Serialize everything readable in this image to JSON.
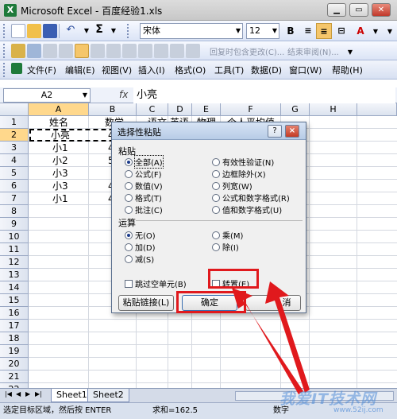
{
  "window": {
    "title": "Microsoft Excel - 百度经验1.xls"
  },
  "toolbar": {
    "autosum": "Σ",
    "font_name": "宋体",
    "font_size": "12",
    "bold": "B",
    "reply_changes": "回复时包含更改(C)...",
    "end_review": "结束审阅(N)..."
  },
  "menu": [
    {
      "label": "文件(F)"
    },
    {
      "label": "编辑(E)"
    },
    {
      "label": "视图(V)"
    },
    {
      "label": "插入(I)"
    },
    {
      "label": "格式(O)"
    },
    {
      "label": "工具(T)"
    },
    {
      "label": "数据(D)"
    },
    {
      "label": "窗口(W)"
    },
    {
      "label": "帮助(H)"
    }
  ],
  "formula": {
    "name_box": "A2",
    "fx": "fx",
    "value": "小亮"
  },
  "grid": {
    "columns": [
      "A",
      "B",
      "C",
      "D",
      "E",
      "F",
      "G",
      "H"
    ],
    "rows": [
      "1",
      "2",
      "3",
      "4",
      "5",
      "6",
      "7",
      "8",
      "9",
      "10",
      "11",
      "12",
      "13",
      "14",
      "15",
      "16",
      "17",
      "18",
      "19",
      "20",
      "21",
      "22"
    ],
    "cells": {
      "r1": [
        "姓名",
        "数学",
        "语文",
        "英语",
        "物理",
        "个人平均值"
      ],
      "a": [
        "小亮",
        "小1",
        "小2",
        "小3",
        "小3",
        "小1"
      ],
      "b": [
        "4",
        "4",
        "5",
        "",
        "4",
        "4"
      ]
    }
  },
  "dialog": {
    "title": "选择性粘贴",
    "help": "?",
    "close": "×",
    "paste_label": "粘贴",
    "paste_options": [
      {
        "label": "全部(A)",
        "selected": true
      },
      {
        "label": "有效性验证(N)"
      },
      {
        "label": "公式(F)"
      },
      {
        "label": "边框除外(X)"
      },
      {
        "label": "数值(V)"
      },
      {
        "label": "列宽(W)"
      },
      {
        "label": "格式(T)"
      },
      {
        "label": "公式和数字格式(R)"
      },
      {
        "label": "批注(C)"
      },
      {
        "label": "值和数字格式(U)"
      }
    ],
    "operation_label": "运算",
    "operation_options": [
      {
        "label": "无(O)",
        "selected": true
      },
      {
        "label": "乘(M)"
      },
      {
        "label": "加(D)"
      },
      {
        "label": "除(I)"
      },
      {
        "label": "减(S)"
      }
    ],
    "skip_blanks": "跳过空单元(B)",
    "transpose": "转置(E)",
    "paste_link_button": "粘贴链接(L)",
    "ok_button": "确定",
    "cancel_button": "消"
  },
  "sheets": {
    "tab1": "Sheet1",
    "tab2": "Sheet2"
  },
  "status": {
    "message": "选定目标区域，然后按 ENTER",
    "sum": "求和=162.5",
    "mode": "数字"
  },
  "watermark": {
    "main": "我爱IT技术网",
    "url": "www.52ij.com"
  },
  "colors": {
    "annotation_red": "#e0191d",
    "selected_header": "#ffd88c",
    "ribbon_blue": "#dbe4f6"
  }
}
